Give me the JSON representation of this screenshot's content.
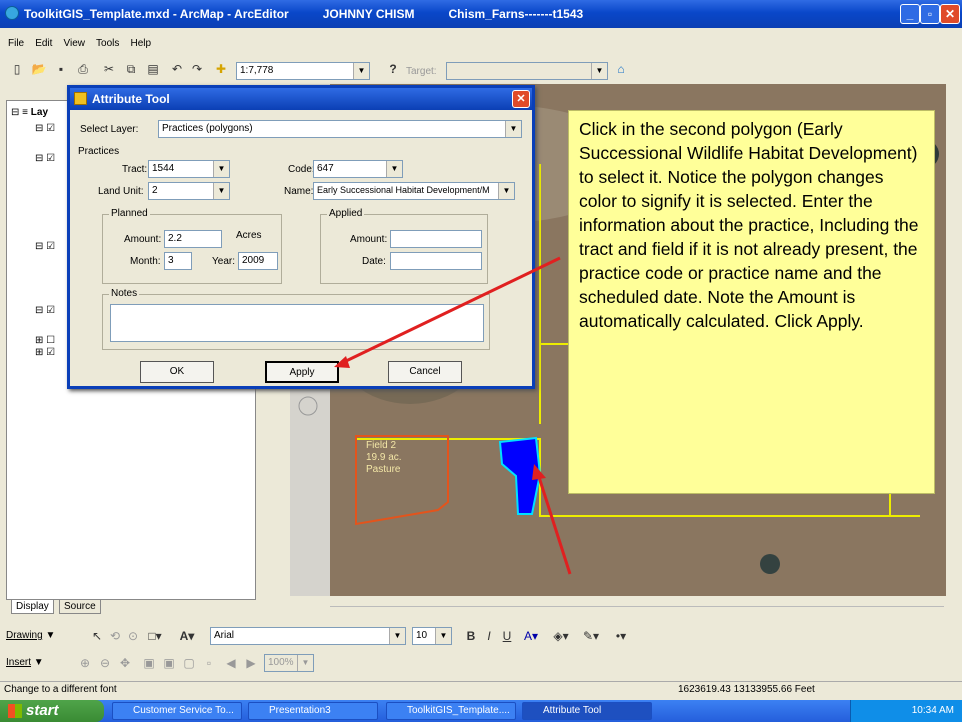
{
  "window": {
    "title": "ToolkitGIS_Template.mxd - ArcMap - ArcEditor",
    "user": "JOHNNY CHISM",
    "file": "Chism_Farns-------t1543"
  },
  "menu": [
    "File",
    "Edit",
    "View",
    "Tools",
    "Help"
  ],
  "toolbar": {
    "scale": "1:7,778",
    "target_label": "Target:"
  },
  "toc": {
    "layers_label": "Lay",
    "tab_display": "Display",
    "tab_source": "Source"
  },
  "dialog": {
    "title": "Attribute Tool",
    "select_layer_label": "Select Layer:",
    "select_layer_value": "Practices (polygons)",
    "practices_label": "Practices",
    "tract_label": "Tract:",
    "tract_value": "1544",
    "code_label": "Code:",
    "code_value": "647",
    "land_unit_label": "Land Unit:",
    "land_unit_value": "2",
    "name_label": "Name:",
    "name_value": "Early Successional Habitat Development/M",
    "planned_label": "Planned",
    "amount_label": "Amount:",
    "amount_value": "2.2",
    "acres_label": "Acres",
    "month_label": "Month:",
    "month_value": "3",
    "year_label": "Year:",
    "year_value": "2009",
    "applied_label": "Applied",
    "applied_amount_label": "Amount:",
    "applied_amount_value": "",
    "date_label": "Date:",
    "date_value": "",
    "notes_label": "Notes",
    "notes_value": "",
    "ok": "OK",
    "apply": "Apply",
    "cancel": "Cancel"
  },
  "map": {
    "field_label": [
      "Field 2",
      "19.9 ac.",
      "Pasture"
    ]
  },
  "callout": "Click in the second polygon (Early Successional Wildlife Habitat Development) to select it. Notice the polygon changes color to signify it is selected. Enter the information about the practice, Including the tract and field if it is not already present, the practice code or practice name and the scheduled date. Note the Amount is automatically calculated. Click Apply.",
  "drawing": {
    "drawing_label": "Drawing",
    "font": "Arial",
    "size": "10",
    "zoom": "100%",
    "insert_label": "Insert"
  },
  "status": {
    "message": "Change to a different font",
    "coords": "1623619.43  13133955.66 Feet"
  },
  "taskbar": {
    "start": "start",
    "tasks": [
      "Customer Service To...",
      "Presentation3",
      "ToolkitGIS_Template....",
      "Attribute Tool"
    ],
    "time": "10:34 AM"
  },
  "colors": {
    "selected_polygon": "#0000ff",
    "callout_bg": "#ffff99",
    "arrow": "#e02020"
  }
}
